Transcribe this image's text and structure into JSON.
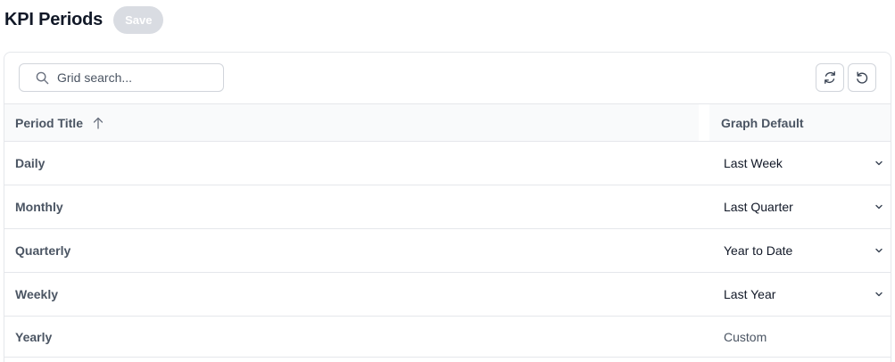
{
  "header": {
    "title": "KPI Periods",
    "save_label": "Save"
  },
  "toolbar": {
    "search_placeholder": "Grid search...",
    "icons": [
      "search-icon",
      "refresh-icon",
      "undo-icon"
    ]
  },
  "grid": {
    "columns": {
      "period_title": "Period Title",
      "graph_default": "Graph Default"
    },
    "sort": "ascending",
    "rows": [
      {
        "title": "Daily",
        "graph_default": "Last Week",
        "editable": true
      },
      {
        "title": "Monthly",
        "graph_default": "Last Quarter",
        "editable": true
      },
      {
        "title": "Quarterly",
        "graph_default": "Year to Date",
        "editable": true
      },
      {
        "title": "Weekly",
        "graph_default": "Last Year",
        "editable": true
      },
      {
        "title": "Yearly",
        "graph_default": "Custom",
        "editable": false
      }
    ]
  },
  "colors": {
    "header_bg": "#f9fafb",
    "border": "#e5e7eb",
    "save_disabled": "#d9dce2",
    "muted_text": "#4b5563"
  }
}
